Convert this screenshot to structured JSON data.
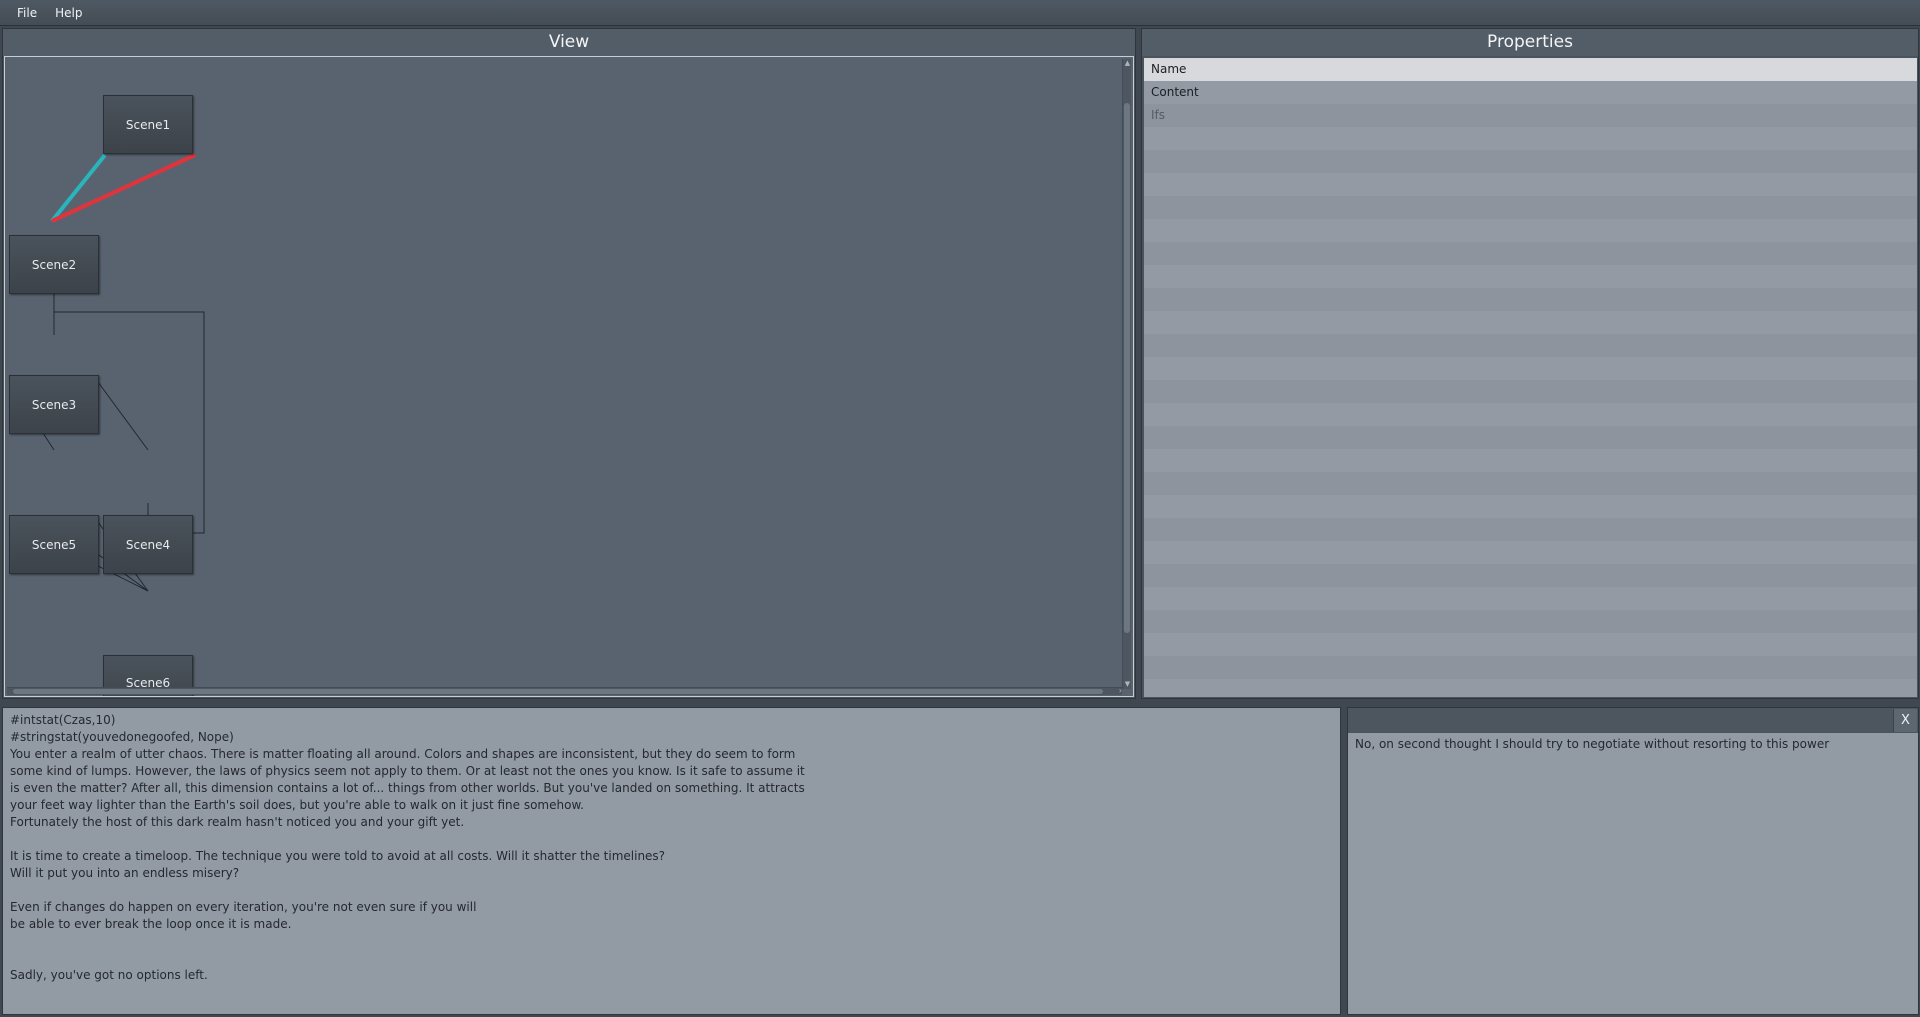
{
  "menu": {
    "file": "File",
    "help": "Help"
  },
  "view": {
    "title": "View",
    "nodes": [
      {
        "id": "scene1",
        "label": "Scene1"
      },
      {
        "id": "scene2",
        "label": "Scene2"
      },
      {
        "id": "scene3",
        "label": "Scene3"
      },
      {
        "id": "scene5",
        "label": "Scene5"
      },
      {
        "id": "scene4",
        "label": "Scene4"
      },
      {
        "id": "scene6",
        "label": "Scene6"
      }
    ],
    "edge_colors": {
      "teal": "#2ab5bd",
      "red": "#e0343d",
      "dark": "#22272c"
    }
  },
  "properties": {
    "title": "Properties",
    "rows": [
      "Name",
      "Content",
      "Ifs"
    ]
  },
  "scene_text": {
    "content": "#intstat(Czas,10)\n#stringstat(youvedonegoofed, Nope)\nYou enter a realm of utter chaos. There is matter floating all around. Colors and shapes are inconsistent, but they do seem to form\nsome kind of lumps. However, the laws of physics seem not apply to them. Or at least not the ones you know. Is it safe to assume it\nis even the matter? After all, this dimension contains a lot of... things from other worlds. But you've landed on something. It attracts\nyour feet way lighter than the Earth's soil does, but you're able to walk on it just fine somehow.\nFortunately the host of this dark realm hasn't noticed you and your gift yet.\n\nIt is time to create a timeloop. The technique you were told to avoid at all costs. Will it shatter the timelines?\nWill it put you into an endless misery?\n\nEven if changes do happen on every iteration, you're not even sure if you will\nbe able to ever break the loop once it is made.\n\n\nSadly, you've got no options left."
  },
  "choice": {
    "close_label": "X",
    "text": "No, on second thought I should try to negotiate without resorting to this power"
  }
}
